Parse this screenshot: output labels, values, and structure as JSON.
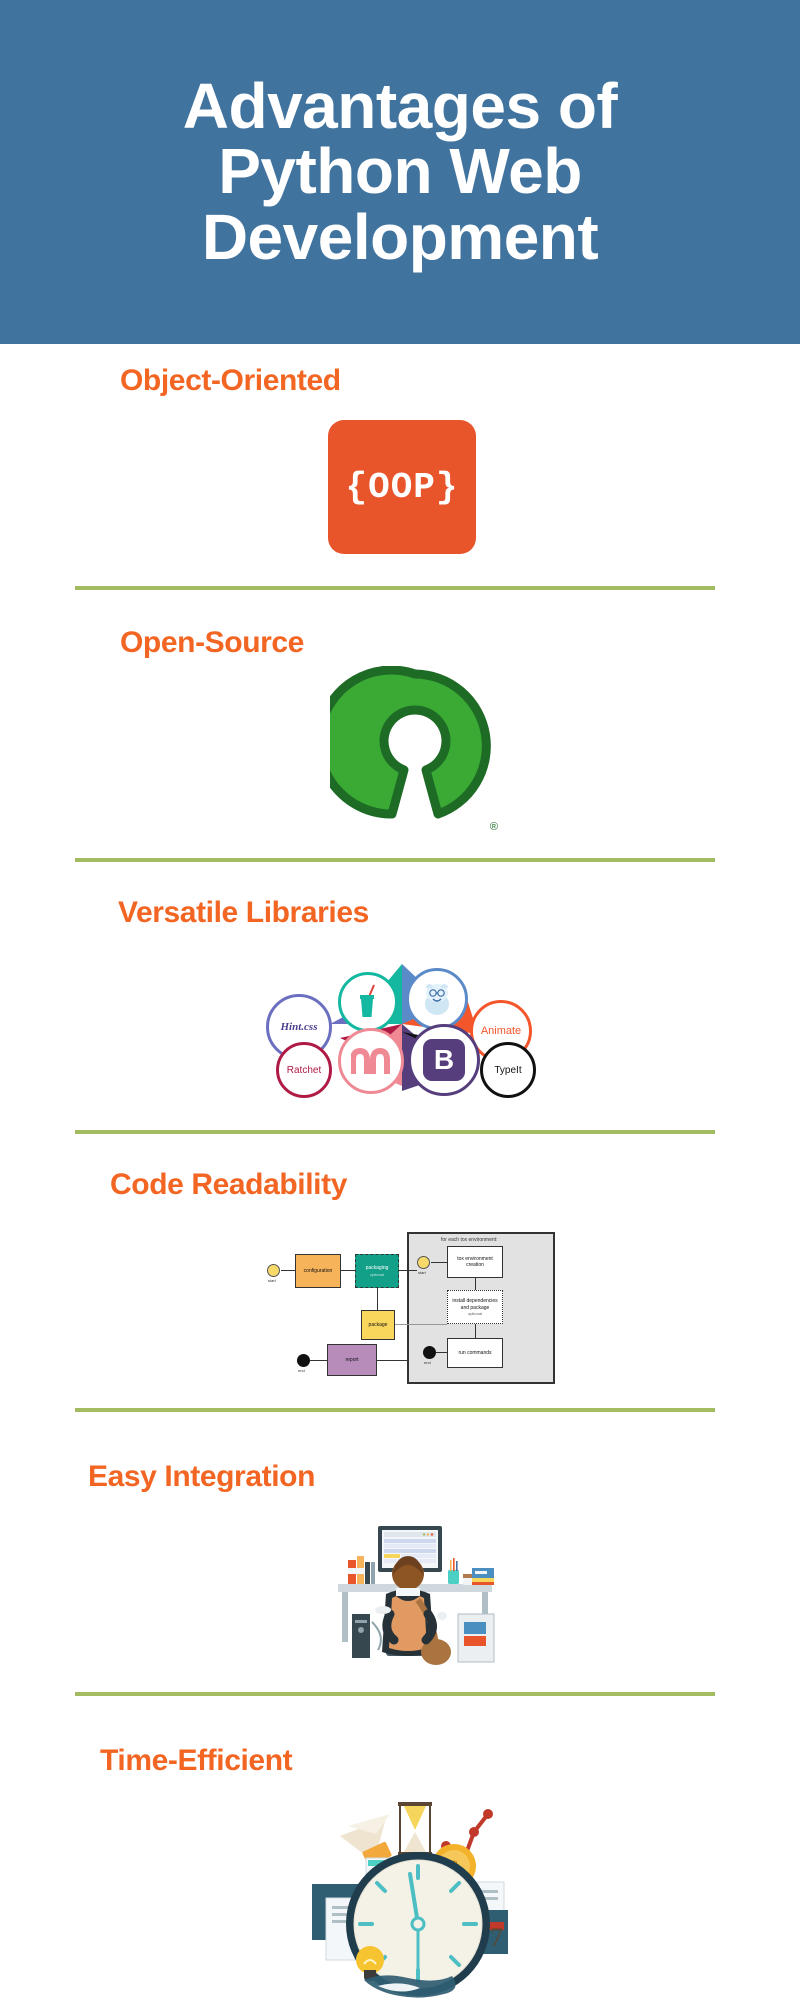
{
  "header": {
    "title": "Advantages of\nPython Web\nDevelopment",
    "background_color": "#41739f",
    "text_color": "#ffffff"
  },
  "theme": {
    "accent_orange": "#f26522",
    "divider_green": "#a3bb61",
    "badge_orange": "#e8552b",
    "osi_green": "#3aaa35",
    "osi_green_dark": "#1d6b25",
    "page_background": "#ffffff"
  },
  "sections": [
    {
      "id": "object-oriented",
      "title": "Object-Oriented",
      "art": "oop-badge",
      "badge_text": "{OOP}"
    },
    {
      "id": "open-source",
      "title": "Open-Source",
      "art": "open-source-logo",
      "registered_mark": "®"
    },
    {
      "id": "versatile-libraries",
      "title": "Versatile Libraries",
      "art": "library-logos-collage",
      "libraries": [
        {
          "name": "Hint.css",
          "color": "#6b6fc0",
          "glyph_kind": "wordmark"
        },
        {
          "name": "Smoothie",
          "color": "#14b8a0",
          "glyph_kind": "cup-icon"
        },
        {
          "name": "Yeti",
          "color": "#5b8ac9",
          "glyph_kind": "yeti-icon"
        },
        {
          "name": "Animate",
          "color": "#f4562c",
          "glyph_kind": "wordmark"
        },
        {
          "name": "Ratchet",
          "color": "#b01b45",
          "glyph_kind": "wordmark"
        },
        {
          "name": "Materialize",
          "color": "#ef8a95",
          "glyph_kind": "m-mark"
        },
        {
          "name": "Bootstrap",
          "color": "#563d7c",
          "glyph_kind": "b-mark",
          "mark": "B"
        },
        {
          "name": "TypeIt",
          "color": "#111111",
          "glyph_kind": "wordmark"
        }
      ]
    },
    {
      "id": "code-readability",
      "title": "Code Readability",
      "art": "tox-flow-diagram",
      "diagram": {
        "group_label": "for each tox environment:",
        "nodes": [
          {
            "label": "configuration"
          },
          {
            "label": "packaging",
            "sublabel": "optional"
          },
          {
            "label": "package"
          },
          {
            "label": "tox environment creation"
          },
          {
            "label": "install dependencies and package",
            "sublabel": "optional"
          },
          {
            "label": "run commands"
          },
          {
            "label": "report"
          }
        ],
        "terminals": [
          "start",
          "start",
          "end",
          "end",
          "end"
        ]
      }
    },
    {
      "id": "easy-integration",
      "title": "Easy Integration",
      "art": "developer-at-desk-illustration"
    },
    {
      "id": "time-efficient",
      "title": "Time-Efficient",
      "art": "clock-productivity-illustration"
    }
  ]
}
